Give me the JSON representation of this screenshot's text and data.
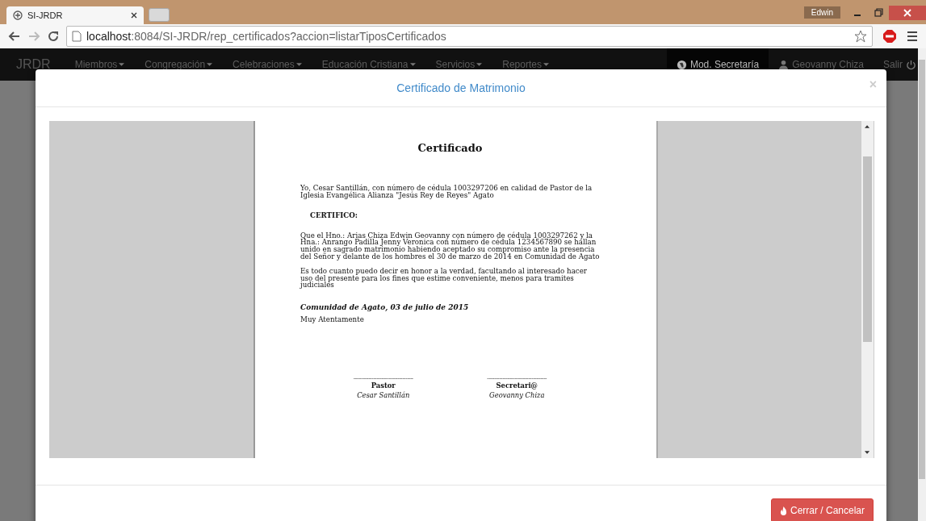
{
  "browser": {
    "tabs": [
      {
        "title": "SI-JRDR",
        "selected": true
      }
    ],
    "profile": "Edwin",
    "url_host": "localhost",
    "url_rest": ":8084/SI-JRDR/rep_certificados?accion=listarTiposCertificados"
  },
  "navbar": {
    "brand": "JRDR",
    "items": [
      {
        "label": "Miembros"
      },
      {
        "label": "Congregación"
      },
      {
        "label": "Celebraciones"
      },
      {
        "label": "Educación Cristiana"
      },
      {
        "label": "Servicios"
      },
      {
        "label": "Reportes"
      }
    ],
    "right_items": [
      {
        "kind": "module",
        "label": "Mod. Secretaría",
        "selected": true
      },
      {
        "kind": "user",
        "label": "Geovanny Chiza",
        "selected": false
      },
      {
        "kind": "logout",
        "label": "Salir",
        "selected": false
      }
    ]
  },
  "modal": {
    "title": "Certificado de Matrimonio",
    "close": "×",
    "document": {
      "heading": "Certificado",
      "intro": "Yo, Cesar Santillán, con número de cédula 1003297206 en calidad de Pastor de la Iglesia Evangélica Alianza \"Jesús Rey de Reyes\" Agato",
      "certifico": "CERTIFICO:",
      "paragraphs": [
        "Que el Hno.: Arias Chiza Edwin Geovanny con número de cédula 1003297262 y la Hna.: Anrango Padilla Jenny Veronica con número de cédula 1234567890 se hallan unido en sagrado matrimonio habiendo aceptado su compromiso ante la presencia del Señor y delante de los hombres el 30 de marzo de 2014 en Comunidad de Agato",
        "Es todo cuanto puedo decir en honor a la verdad, facultando al interesado hacer uso del presente para los fines que estime conveniente, menos para tramites judiciales"
      ],
      "place_date": "Comunidad de Agato, 03 de julio de 2015",
      "closing": "Muy Atentamente",
      "signatures": [
        {
          "line": "---------------------------------------",
          "role": "Pastor",
          "name": "Cesar Santillán"
        },
        {
          "line": "---------------------------------------",
          "role": "Secretari@",
          "name": "Geovanny Chiza"
        }
      ]
    },
    "button": "Cerrar / Cancelar"
  }
}
